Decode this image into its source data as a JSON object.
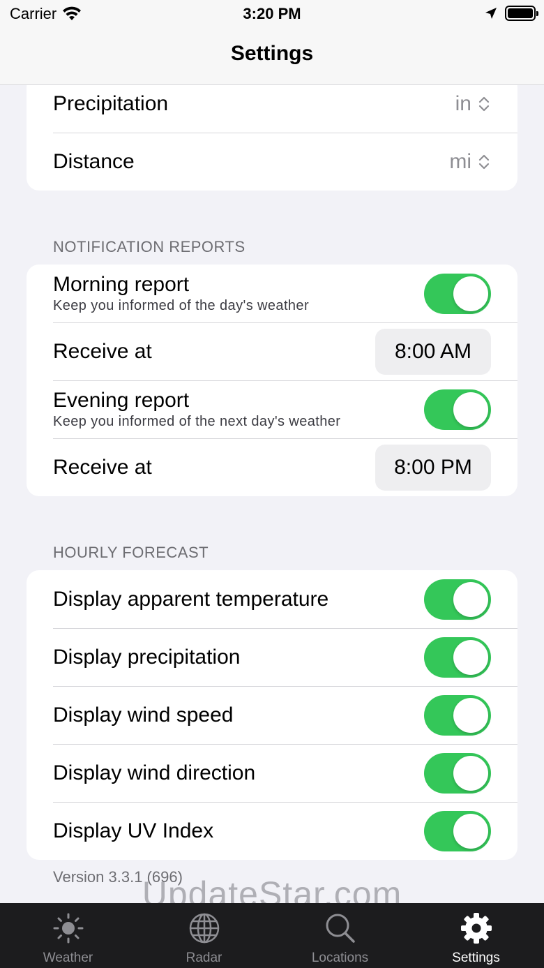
{
  "status_bar": {
    "carrier": "Carrier",
    "time": "3:20 PM"
  },
  "nav": {
    "title": "Settings"
  },
  "units": [
    {
      "label": "Precipitation",
      "value": "in"
    },
    {
      "label": "Distance",
      "value": "mi"
    }
  ],
  "notification_reports": {
    "header": "NOTIFICATION REPORTS",
    "morning": {
      "label": "Morning report",
      "subtitle": "Keep you informed of the day's weather",
      "enabled": true
    },
    "morning_receive": {
      "label": "Receive at",
      "time": "8:00 AM"
    },
    "evening": {
      "label": "Evening report",
      "subtitle": "Keep you informed of the next day's weather",
      "enabled": true
    },
    "evening_receive": {
      "label": "Receive at",
      "time": "8:00 PM"
    }
  },
  "hourly_forecast": {
    "header": "HOURLY FORECAST",
    "items": [
      {
        "label": "Display apparent temperature",
        "enabled": true
      },
      {
        "label": "Display precipitation",
        "enabled": true
      },
      {
        "label": "Display wind speed",
        "enabled": true
      },
      {
        "label": "Display wind direction",
        "enabled": true
      },
      {
        "label": "Display UV Index",
        "enabled": true
      }
    ]
  },
  "version": "Version 3.3.1 (696)",
  "watermark": "UpdateStar.com",
  "tabs": [
    {
      "label": "Weather",
      "icon": "sun-icon"
    },
    {
      "label": "Radar",
      "icon": "globe-icon"
    },
    {
      "label": "Locations",
      "icon": "search-icon"
    },
    {
      "label": "Settings",
      "icon": "gear-icon",
      "active": true
    }
  ],
  "colors": {
    "accent_toggle": "#34c759",
    "background": "#f2f2f7",
    "tabbar": "#1c1c1e"
  }
}
